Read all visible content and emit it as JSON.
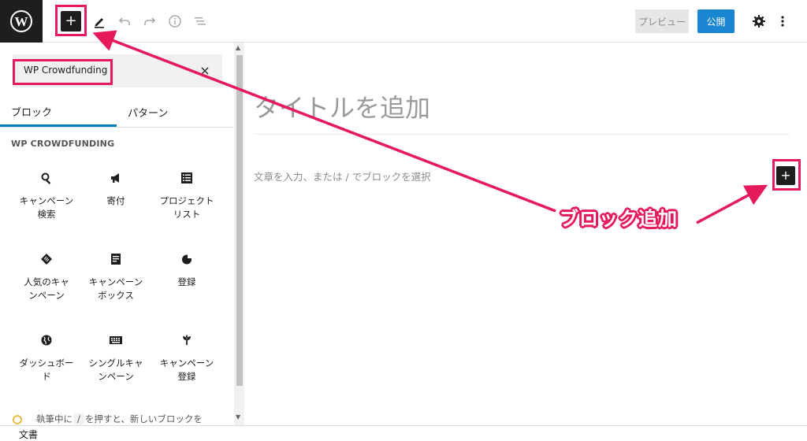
{
  "toolbar": {
    "add_symbol": "+",
    "preview_label": "プレビュー",
    "publish_label": "公開"
  },
  "inserter": {
    "search_value": "WP Crowdfunding",
    "clear_symbol": "×",
    "tabs": [
      {
        "label": "ブロック"
      },
      {
        "label": "パターン"
      }
    ],
    "category_title": "WP CROWDFUNDING",
    "blocks": [
      {
        "label": "キャンペーン\n検索",
        "icon": "search-icon"
      },
      {
        "label": "寄付",
        "icon": "megaphone-icon"
      },
      {
        "label": "プロジェクト\nリスト",
        "icon": "list-icon"
      },
      {
        "label": "人気のキャ\nンペーン",
        "icon": "tag-icon"
      },
      {
        "label": "キャンペーン\nボックス",
        "icon": "document-icon"
      },
      {
        "label": "登録",
        "icon": "pie-icon"
      },
      {
        "label": "ダッシュボー\nド",
        "icon": "globe-icon"
      },
      {
        "label": "シングルキャ\nンペーン",
        "icon": "keyboard-icon"
      },
      {
        "label": "キャンペーン\n登録",
        "icon": "plant-icon"
      }
    ],
    "tip_before": "執筆中に",
    "tip_key": "/",
    "tip_after": "を押すと、新しいブロックを"
  },
  "editor": {
    "title_placeholder": "タイトルを追加",
    "paragraph_placeholder": "文章を入力、または / でブロックを選択",
    "inline_add_symbol": "+"
  },
  "statusbar": {
    "label": "文書"
  },
  "annotation": {
    "callout_text": "ブロック追加",
    "color": "#e6195a"
  }
}
